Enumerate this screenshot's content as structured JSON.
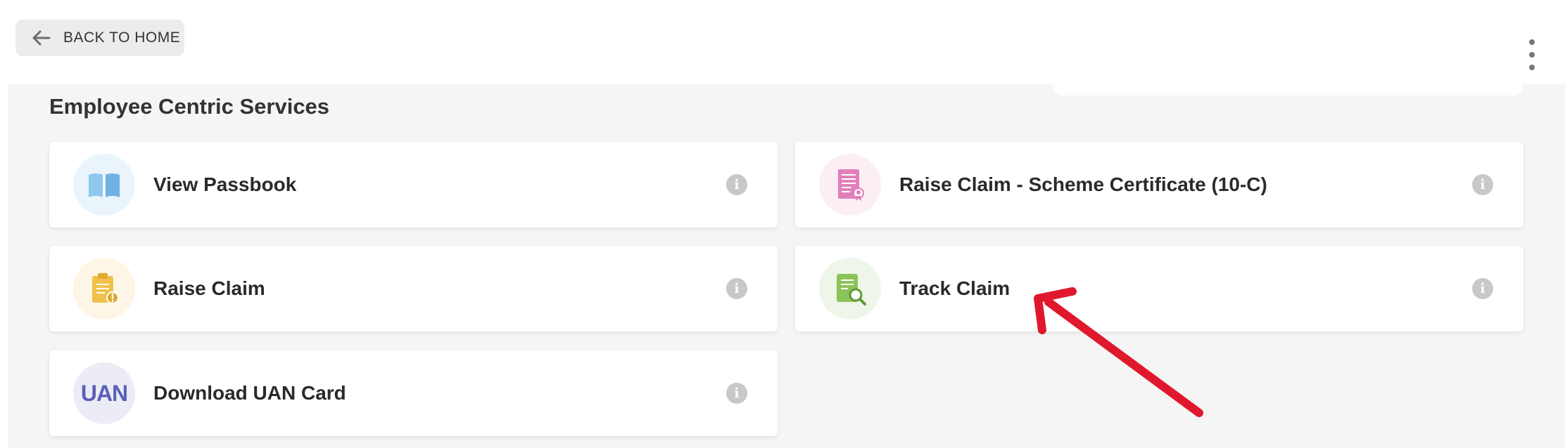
{
  "header": {
    "back_label": "BACK TO HOME",
    "back_icon": "arrow-left-icon",
    "menu_icon": "kebab-menu-icon"
  },
  "section": {
    "title": "Employee Centric Services"
  },
  "services": [
    {
      "label": "View Passbook",
      "icon": "book-icon",
      "accent": "#6fb3e6"
    },
    {
      "label": "Raise Claim - Scheme Certificate (10-C)",
      "icon": "certificate-icon",
      "accent": "#e27fb8"
    },
    {
      "label": "Raise Claim",
      "icon": "claim-document-icon",
      "accent": "#f0c14b"
    },
    {
      "label": "Track Claim",
      "icon": "document-search-icon",
      "accent": "#8dc35b"
    },
    {
      "label": "Download UAN Card",
      "icon": "uan-icon",
      "icon_text": "UAN",
      "accent": "#5a60b8"
    }
  ],
  "info_icon": {
    "glyph": "i",
    "name": "info-icon"
  },
  "annotation": {
    "color": "#e0182d",
    "icon": "red-arrow-annotation"
  }
}
